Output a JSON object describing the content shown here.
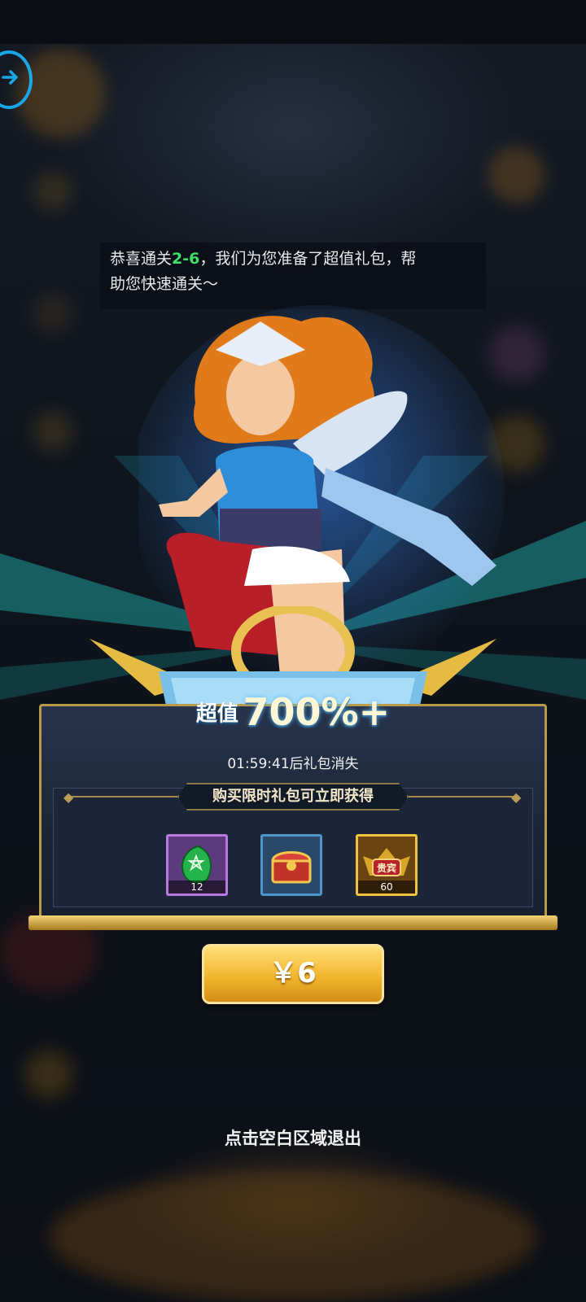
{
  "tip": {
    "prefix": "恭喜通关",
    "stage": "2-6",
    "line1_rest": "，我们为您准备了超值礼包，帮",
    "line2": "助您快速通关～"
  },
  "badge": {
    "label": "超值",
    "value": "700%+"
  },
  "timer": "01:59:41后礼包消失",
  "subtitle": "购买限时礼包可立即获得",
  "items": [
    {
      "name": "green-gem",
      "count": "12",
      "border": "#b77be0"
    },
    {
      "name": "treasure-chest",
      "count": "",
      "border": "#4f94c8"
    },
    {
      "name": "vip-emblem",
      "count": "60",
      "border": "#f1c33c"
    }
  ],
  "price_button": "￥6",
  "exit_hint": "点击空白区域退出",
  "colors": {
    "accent_blue": "#1aa7e8",
    "highlight_green": "#3ee06a",
    "gold": "#f2b62e"
  }
}
